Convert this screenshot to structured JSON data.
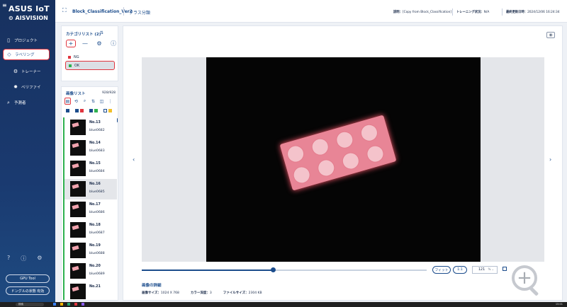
{
  "sidebar": {
    "logo_top": "ASUS IoT",
    "logo_bottom": "AISVISION",
    "items": [
      {
        "label": "プロジェクト",
        "icon": "document-icon"
      },
      {
        "label": "ラベリング",
        "icon": "tag-icon",
        "active": true
      },
      {
        "label": "トレーナー",
        "icon": "gear-icon"
      },
      {
        "label": "ベリファイ",
        "icon": "verify-icon"
      },
      {
        "label": "予測者",
        "icon": "search-icon"
      }
    ],
    "bottom_icons": [
      "help-icon",
      "info-icon",
      "settings-icon"
    ],
    "gpu_tool_label": "GPU Tool",
    "dongle_label": "ドングルの状態 有効"
  },
  "header": {
    "project_name": "Block_Classification_Ver2",
    "project_type": "クラス分類",
    "description_label": "説明：",
    "description_value": "[Copy from Block_Classification]",
    "training_label": "トレーニング状況：",
    "training_value": "N/A",
    "updated_label": "最終更新日時：",
    "updated_value": "2024/12/06 16:24:34"
  },
  "category_panel": {
    "title": "カテゴリリスト (2)",
    "add_icon": "+",
    "remove_icon": "—",
    "categories": [
      {
        "name": "NG",
        "color": "#e0353f"
      },
      {
        "name": "OK",
        "color": "#2fb14f",
        "selected": true
      }
    ]
  },
  "image_panel": {
    "title": "画像リスト",
    "count": "928/928",
    "filter_colors": [
      "#1b4c8c",
      "#e0353f",
      "#2fb14f",
      "#f2c029"
    ],
    "rows": [
      {
        "no": "No.13",
        "name": "blue0682"
      },
      {
        "no": "No.14",
        "name": "blue0683"
      },
      {
        "no": "No.15",
        "name": "blue0684"
      },
      {
        "no": "No.16",
        "name": "blue0685",
        "selected": true
      },
      {
        "no": "No.17",
        "name": "blue0686"
      },
      {
        "no": "No.18",
        "name": "blue0687"
      },
      {
        "no": "No.19",
        "name": "blue0688"
      },
      {
        "no": "No.20",
        "name": "blue0689"
      },
      {
        "no": "No.21",
        "name": ""
      }
    ]
  },
  "viewer": {
    "fit_label": "フィット",
    "one_to_one_label": "1:1",
    "zoom_value": "121",
    "zoom_unit": "%",
    "slider_position": 0.46,
    "details_title": "画像の詳細",
    "size_label": "画像サイズ：",
    "size_value": "1024 X 768",
    "color_depth_label": "カラー深度：",
    "color_depth_value": "3",
    "file_size_label": "ファイルサイズ：",
    "file_size_value": "2304 KB"
  },
  "taskbar": {
    "search_placeholder": "検索",
    "time": "15:01"
  }
}
